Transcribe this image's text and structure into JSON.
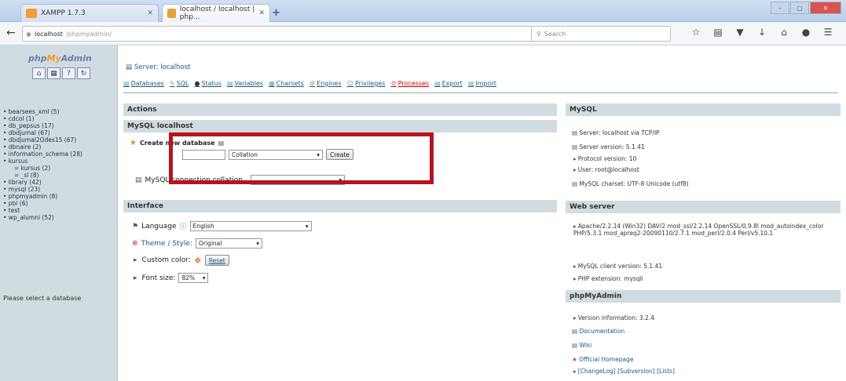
{
  "browser": {
    "tabs": [
      {
        "label": "XAMPP 1.7.3"
      },
      {
        "label": "localhost / localhost | php..."
      }
    ],
    "url_host": "localhost",
    "url_path": "/phpmyadmin/",
    "search_placeholder": "Search",
    "window_controls": [
      "–",
      "▢",
      "✕"
    ]
  },
  "sidebar": {
    "logo_pre": "php",
    "logo_my": "My",
    "logo_post": "Admin",
    "quick_icons": [
      "home-icon",
      "sql-icon",
      "docs-icon",
      "reload-icon"
    ],
    "databases": [
      {
        "label": "• bearsees_xml (5)"
      },
      {
        "label": "• cdcol (1)"
      },
      {
        "label": "• db_pepsus (17)"
      },
      {
        "label": "• dbdjumal (67)"
      },
      {
        "label": "• dbdjumal2Odes15 (67)"
      },
      {
        "label": "• dbnaire (2)"
      },
      {
        "label": "• information_schema (28)"
      },
      {
        "label": "• kursus"
      },
      {
        "label": "= kursus (2)",
        "sub": true
      },
      {
        "label": "= _sl (8)",
        "sub": true
      },
      {
        "label": "• library (42)"
      },
      {
        "label": "• mysql (23)"
      },
      {
        "label": "• phpmyadmin (8)"
      },
      {
        "label": "• pbi (6)"
      },
      {
        "label": "• test"
      },
      {
        "label": "• wp_alumni (52)"
      }
    ],
    "select_message": "Please select a database"
  },
  "main": {
    "server_crumb": "Server: localhost",
    "tabs": [
      {
        "label": "Databases"
      },
      {
        "label": "SQL"
      },
      {
        "label": "Status"
      },
      {
        "label": "Variables"
      },
      {
        "label": "Charsets"
      },
      {
        "label": "Engines"
      },
      {
        "label": "Privileges"
      },
      {
        "label": "Processes"
      },
      {
        "label": "Export"
      },
      {
        "label": "Import"
      }
    ],
    "actions": {
      "header": "Actions",
      "mysql_localhost": "MySQL localhost",
      "create_db_label": "Create new database",
      "collation_placeholder": "Collation",
      "create_button": "Create",
      "connection_collation_label": "MySQL connection collation"
    },
    "interface": {
      "header": "Interface",
      "language_label": "Language",
      "language_value": "English",
      "theme_label": "Theme / Style:",
      "theme_value": "Original",
      "custom_color_label": "Custom color:",
      "reset_button": "Reset",
      "font_size_label": "Font size:",
      "font_size_value": "82%"
    },
    "mysql_panel": {
      "header": "MySQL",
      "items": [
        "Server: localhost via TCP/IP",
        "Server version: 5.1.41",
        "Protocol version: 10",
        "User: root@localhost",
        "MySQL charset: UTF-8 Unicode (utf8)"
      ]
    },
    "web_panel": {
      "header": "Web server",
      "items": [
        "Apache/2.2.14 (Win32) DAV/2 mod_ssl/2.2.14 OpenSSL/0.9.8l mod_autoindex_color PHP/5.3.1 mod_apreq2-20090110/2.7.1 mod_perl/2.0.4 Perl/v5.10.1",
        "MySQL client version: 5.1.41",
        "PHP extension: mysqli"
      ]
    },
    "pma_panel": {
      "header": "phpMyAdmin",
      "items": [
        "Version information: 3.2.4",
        "Documentation",
        "Wiki",
        "Official Homepage",
        "[ChangeLog] [Subversion] [Lists]"
      ]
    }
  }
}
